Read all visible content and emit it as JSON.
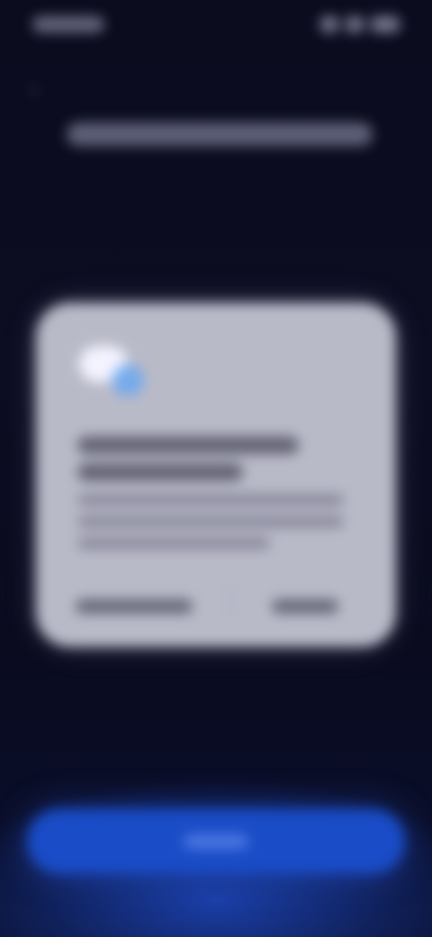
{
  "status_bar": {
    "time": "",
    "icons": [
      "signal-icon",
      "wifi-icon",
      "battery-icon"
    ]
  },
  "header": {
    "back_icon": "back-arrow-icon",
    "title": ""
  },
  "dialog": {
    "icon": "cloud-sync-icon",
    "title_line_1": "",
    "title_line_2": "",
    "body_line_1": "",
    "body_line_2": "",
    "body_line_3": "",
    "secondary_button": "",
    "primary_button": ""
  },
  "bottom_button": {
    "label": ""
  },
  "colors": {
    "background": "#0b0c1e",
    "dialog": "#b9bac8",
    "accent_blue": "#1a4cc7",
    "icon_blue": "#6aa7f0"
  }
}
